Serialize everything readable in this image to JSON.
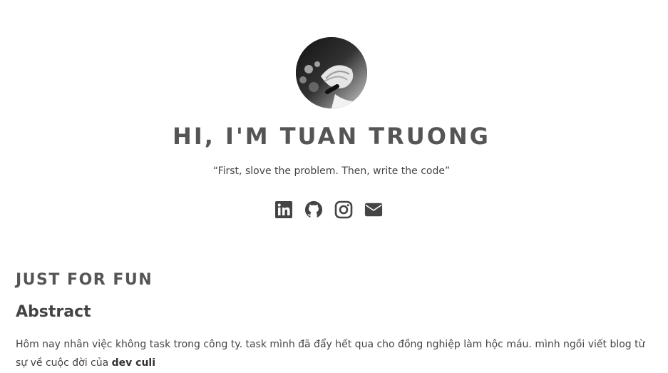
{
  "profile": {
    "avatar_alt": "profile photo",
    "title": "HI, I'M TUAN TRUONG",
    "quote": "“First, slove the problem. Then, write the code”"
  },
  "socials": [
    {
      "name": "linkedin-icon",
      "label": "LinkedIn"
    },
    {
      "name": "github-icon",
      "label": "GitHub"
    },
    {
      "name": "instagram-icon",
      "label": "Instagram"
    },
    {
      "name": "email-icon",
      "label": "Email"
    }
  ],
  "section": {
    "title": "JUST FOR FUN"
  },
  "post": {
    "heading": "Abstract",
    "text": "Hôm nay nhân việc không task trong công ty. task mình đã đẩy hết qua cho đồng nghiệp làm hộc máu. mình ngồi viết blog từ sự về cuộc đời của ",
    "bold": "dev culi"
  },
  "colors": {
    "icon": "#444444",
    "heading": "#555555",
    "text": "#444444"
  }
}
